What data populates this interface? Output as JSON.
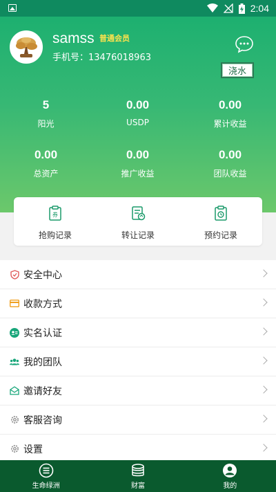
{
  "status_bar": {
    "time": "2:04"
  },
  "profile": {
    "username": "samss",
    "member_badge": "普通会员",
    "phone": "手机号：13476018963",
    "water_button": "浇水"
  },
  "stats": [
    {
      "value": "5",
      "label": "阳光"
    },
    {
      "value": "0.00",
      "label": "USDP"
    },
    {
      "value": "0.00",
      "label": "累计收益"
    },
    {
      "value": "0.00",
      "label": "总资产"
    },
    {
      "value": "0.00",
      "label": "推广收益"
    },
    {
      "value": "0.00",
      "label": "团队收益"
    }
  ],
  "records": [
    {
      "label": "抢购记录",
      "icon": "clipboard-voucher-icon"
    },
    {
      "label": "转让记录",
      "icon": "document-transfer-icon"
    },
    {
      "label": "预约记录",
      "icon": "clipboard-clock-icon"
    }
  ],
  "menu": [
    {
      "label": "安全中心",
      "icon": "shield-icon",
      "color": "#e05a5a"
    },
    {
      "label": "收款方式",
      "icon": "card-icon",
      "color": "#f0a020"
    },
    {
      "label": "实名认证",
      "icon": "id-card-icon",
      "color": "#18a67a"
    },
    {
      "label": "我的团队",
      "icon": "team-icon",
      "color": "#18a67a"
    },
    {
      "label": "邀请好友",
      "icon": "envelope-icon",
      "color": "#18a67a"
    },
    {
      "label": "客服咨询",
      "icon": "gear-icon",
      "color": "#888888"
    },
    {
      "label": "设置",
      "icon": "gear-icon",
      "color": "#888888"
    }
  ],
  "tabs": [
    {
      "label": "生命绿洲",
      "icon": "menu-circle-icon"
    },
    {
      "label": "财富",
      "icon": "database-icon"
    },
    {
      "label": "我的",
      "icon": "user-circle-icon"
    }
  ],
  "colors": {
    "status_bar": "#0f8a5f",
    "hero_top": "#1db070",
    "hero_bottom": "#6cc86b",
    "tab_bar": "#0a5a2e",
    "badge": "#ffe34d"
  }
}
